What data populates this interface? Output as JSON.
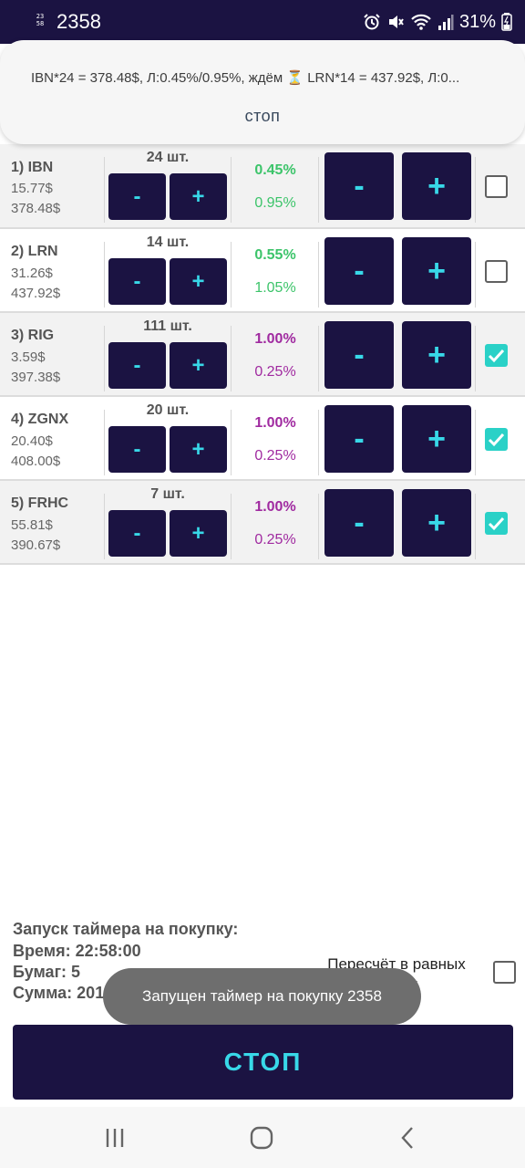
{
  "status_bar": {
    "app_icon_text": "23 58",
    "time": "2358",
    "battery": "31%",
    "icons": [
      "alarm-icon",
      "mute-icon",
      "wifi-icon",
      "signal-icon",
      "battery-icon"
    ]
  },
  "notification": {
    "text": "IBN*24 = 378.48$, Л:0.45%/0.95%, ждём ⏳ LRN*14 = 437.92$, Л:0...",
    "action_label": "стоп"
  },
  "rows": [
    {
      "name": "1) IBN",
      "price": "15.77$",
      "sum": "378.48$",
      "qty": "24 шт.",
      "pct1": "0.45%",
      "pct2": "0.95%",
      "pct1_color": "#3cc46a",
      "pct2_color": "#3cc46a",
      "checked": false
    },
    {
      "name": "2) LRN",
      "price": "31.26$",
      "sum": "437.92$",
      "qty": "14 шт.",
      "pct1": "0.55%",
      "pct2": "1.05%",
      "pct1_color": "#3cc46a",
      "pct2_color": "#3cc46a",
      "checked": false
    },
    {
      "name": "3) RIG",
      "price": "3.59$",
      "sum": "397.38$",
      "qty": "111 шт.",
      "pct1": "1.00%",
      "pct2": "0.25%",
      "pct1_color": "#a02aa0",
      "pct2_color": "#a02aa0",
      "checked": true
    },
    {
      "name": "4) ZGNX",
      "price": "20.40$",
      "sum": "408.00$",
      "qty": "20 шт.",
      "pct1": "1.00%",
      "pct2": "0.25%",
      "pct1_color": "#a02aa0",
      "pct2_color": "#a02aa0",
      "checked": true
    },
    {
      "name": "5) FRHC",
      "price": "55.81$",
      "sum": "390.67$",
      "qty": "7 шт.",
      "pct1": "1.00%",
      "pct2": "0.25%",
      "pct1_color": "#a02aa0",
      "pct2_color": "#a02aa0",
      "checked": true
    }
  ],
  "buttons": {
    "minus": "-",
    "plus": "+"
  },
  "info": {
    "title": "Запуск таймера на покупку:",
    "time": "Время: 22:58:00",
    "papers": "Бумаг: 5",
    "sum": "Сумма: 2012.45$"
  },
  "recalc_label": "Пересчёт в равных долях",
  "recalc_checked": false,
  "toast": "Запущен таймер на покупку 2358",
  "stop_button": "СТОП",
  "colors": {
    "primary": "#1b1342",
    "accent": "#38d8e8",
    "check": "#2ad1c7"
  }
}
